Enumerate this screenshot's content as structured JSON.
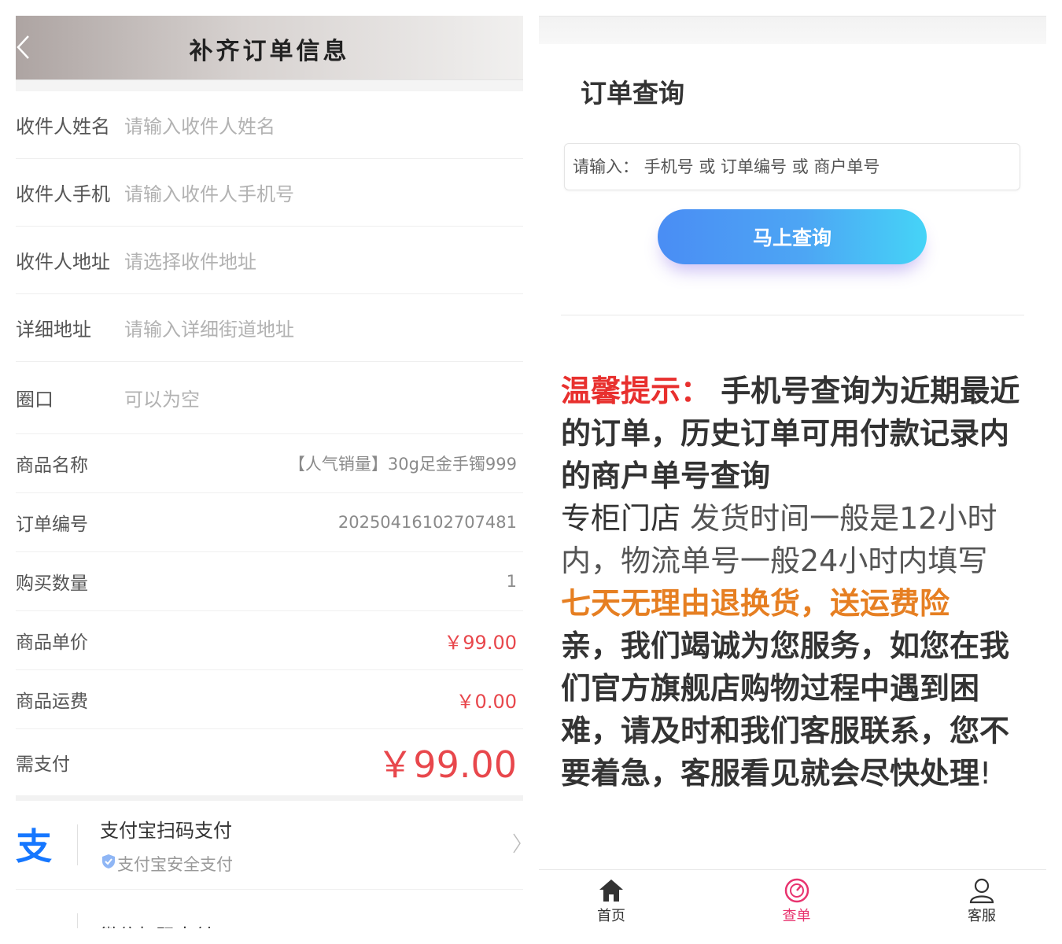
{
  "left": {
    "header": {
      "title": "补齐订单信息",
      "back_icon": "chevron-left-icon"
    },
    "form": {
      "receiver_name": {
        "label": "收件人姓名",
        "placeholder": "请输入收件人姓名"
      },
      "receiver_phone": {
        "label": "收件人手机",
        "placeholder": "请输入收件人手机号"
      },
      "receiver_address": {
        "label": "收件人地址",
        "placeholder": "请选择收件地址"
      },
      "detail_address": {
        "label": "详细地址",
        "placeholder": "请输入详细街道地址"
      },
      "ring_size": {
        "label": "圈口",
        "placeholder": "可以为空"
      }
    },
    "order": {
      "product_name": {
        "label": "商品名称",
        "value": "【人气销量】30g足金手镯999"
      },
      "order_no": {
        "label": "订单编号",
        "value": "20250416102707481"
      },
      "quantity": {
        "label": "购买数量",
        "value": "1"
      },
      "unit_price": {
        "label": "商品单价",
        "value": "￥99.00"
      },
      "shipping": {
        "label": "商品运费",
        "value": "￥0.00"
      },
      "total": {
        "label": "需支付",
        "value": "￥99.00"
      }
    },
    "payment": [
      {
        "name": "支付宝扫码支付",
        "sub": "支付宝安全支付",
        "icon": "alipay-icon"
      },
      {
        "name": "微信扫码支付",
        "icon": "wechat-icon"
      }
    ],
    "colors": {
      "price_red": "#e8474c",
      "alipay_blue": "#1677ff",
      "wechat_green": "#43b935"
    }
  },
  "right": {
    "query": {
      "title": "订单查询",
      "placeholder": "请输入： 手机号 或 订单编号 或 商户单号",
      "button": "马上查询"
    },
    "notice": {
      "tip_label": "温馨提示：",
      "tip_text": " 手机号查询为近期最近的订单，历史订单可用付款记录内的商户单号查询",
      "store": "专柜门店",
      "shipping_text": " 发货时间一般是12小时内，物流单号一般24小时内填写",
      "return_policy": "七天无理由退换货，送运费险",
      "service_text": "亲，我们竭诚为您服务，如您在我们官方旗舰店购物过程中遇到困难，请及时和我们客服联系，您不要着急，客服看见就会尽快处理",
      "service_end": "!"
    },
    "tabs": [
      {
        "label": "首页",
        "icon": "home-icon"
      },
      {
        "label": "查单",
        "icon": "query-order-icon",
        "active": true
      },
      {
        "label": "客服",
        "icon": "customer-service-icon"
      }
    ],
    "colors": {
      "tip_red": "#e8302e",
      "policy_orange": "#e67f22",
      "tab_active": "#e8346f",
      "button_gradient_start": "#4a8df4",
      "button_gradient_end": "#45d4f7"
    }
  }
}
